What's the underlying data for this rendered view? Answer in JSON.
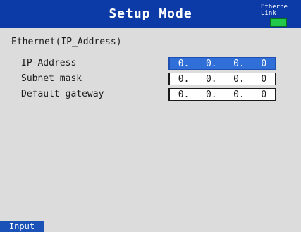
{
  "header": {
    "title": "Setup Mode",
    "ethernet_status": "Etherne\nLink",
    "link_led_color": "#22c84a"
  },
  "section_title": "Ethernet(IP_Address)",
  "fields": [
    {
      "label": "IP-Address",
      "octets": [
        "0.",
        "0.",
        "0.",
        "0"
      ],
      "selected": true
    },
    {
      "label": "Subnet mask",
      "octets": [
        "0.",
        "0.",
        "0.",
        "0"
      ],
      "selected": false
    },
    {
      "label": "Default gateway",
      "octets": [
        "0.",
        "0.",
        "0.",
        "0"
      ],
      "selected": false
    }
  ],
  "softkeys": {
    "input_label": "Input"
  },
  "colors": {
    "title_bar": "#0c3aa6",
    "selection": "#2f6fd7",
    "background": "#dcdcdc"
  }
}
